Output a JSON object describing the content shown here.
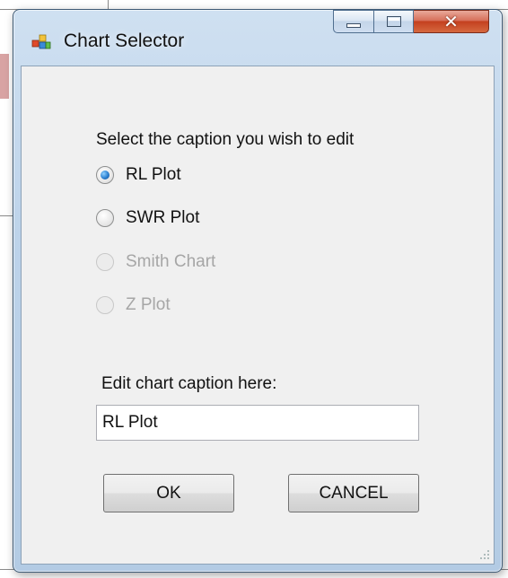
{
  "window": {
    "title": "Chart Selector",
    "icon": "chart-app-icon"
  },
  "dialog": {
    "prompt": "Select the caption you wish to edit",
    "options": [
      {
        "label": "RL Plot",
        "checked": true,
        "enabled": true
      },
      {
        "label": "SWR Plot",
        "checked": false,
        "enabled": true
      },
      {
        "label": "Smith Chart",
        "checked": false,
        "enabled": false
      },
      {
        "label": "Z Plot",
        "checked": false,
        "enabled": false
      }
    ],
    "edit_label": "Edit chart caption here:",
    "caption_value": "RL Plot",
    "ok_label": "OK",
    "cancel_label": "CANCEL"
  },
  "colors": {
    "frame": "#bdd3ea",
    "close_button": "#c4401f",
    "client_bg": "#f0f0f0"
  }
}
